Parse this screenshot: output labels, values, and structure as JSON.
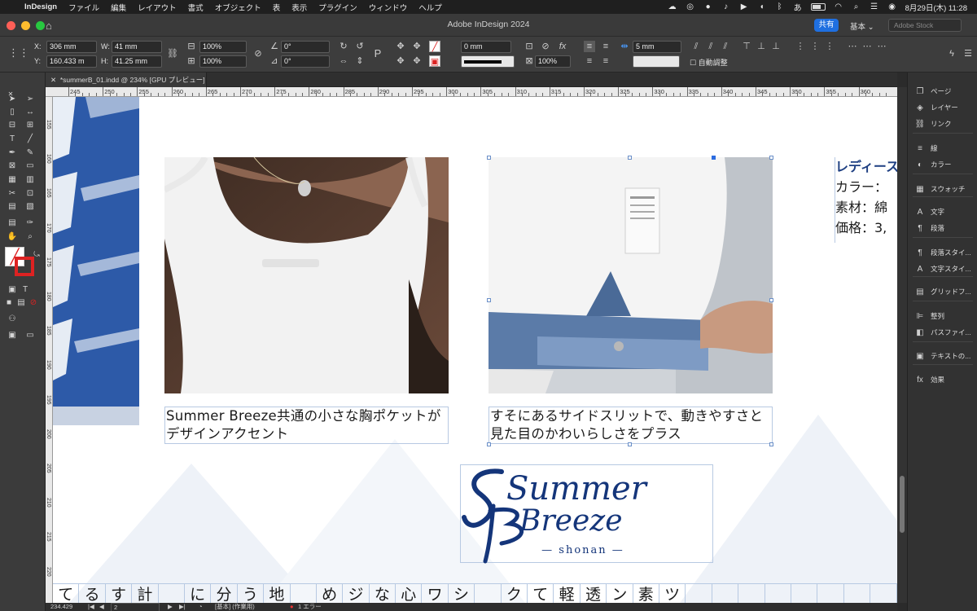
{
  "menubar": {
    "app_name": "InDesign",
    "items": [
      "ファイル",
      "編集",
      "レイアウト",
      "書式",
      "オブジェクト",
      "表",
      "表示",
      "プラグイン",
      "ウィンドウ",
      "ヘルプ"
    ],
    "ime": "あ",
    "datetime": "8月29日(木) 11:28"
  },
  "window": {
    "title": "Adobe InDesign 2024",
    "share_label": "共有",
    "workspace_label": "基本 ⌄",
    "stock_placeholder": "Adobe Stock"
  },
  "control": {
    "x_label": "X:",
    "x_value": "306 mm",
    "y_label": "Y:",
    "y_value": "160.433 m",
    "w_label": "W:",
    "w_value": "41 mm",
    "h_label": "H:",
    "h_value": "41.25 mm",
    "scale_x": "100%",
    "scale_y": "100%",
    "rotate": "0°",
    "shear": "0°",
    "stroke_weight": "0 mm",
    "opacity": "100%",
    "gap": "5 mm",
    "auto_fit_label": "自動調整"
  },
  "tab": {
    "label": "*summerB_01.indd @ 234% [GPU プレビュー]"
  },
  "rulers": {
    "top": [
      "245",
      "250",
      "255",
      "260",
      "265",
      "270",
      "275",
      "280",
      "285",
      "290",
      "295",
      "300",
      "305",
      "310",
      "315",
      "320",
      "325",
      "330",
      "335",
      "340",
      "345",
      "350",
      "355",
      "360"
    ],
    "left": [
      "155",
      "160",
      "165",
      "170",
      "175",
      "180",
      "185",
      "190",
      "195",
      "200",
      "205",
      "210",
      "215",
      "220"
    ]
  },
  "document": {
    "caption1": "Summer Breeze共通の小さな胸ポケットがデザインアクセント",
    "caption2": "すそにあるサイドスリットで、動きやすさと見た目のかわいらしさをプラス",
    "right_title": "レディース",
    "right_lines": [
      "カラー：",
      "素材：綿",
      "価格：3,"
    ],
    "logo_line1": "Summer",
    "logo_line2": "Breeze",
    "logo_sub": "— shonan —",
    "bottom_chars": [
      "て",
      "る",
      "す",
      "計",
      "",
      "に",
      "分",
      "う",
      "地",
      "",
      "め",
      "ジ",
      "な",
      "心",
      "ワ",
      "シ",
      "",
      "ク",
      "て",
      "軽",
      "透",
      "ン",
      "素",
      "ツ",
      "",
      "",
      "",
      "",
      "",
      "",
      "",
      ""
    ]
  },
  "panels": [
    {
      "name": "pages",
      "icon": "pages-icon",
      "label": "ページ"
    },
    {
      "name": "layers",
      "icon": "layers-icon",
      "label": "レイヤー"
    },
    {
      "name": "links",
      "icon": "link-icon",
      "label": "リンク"
    },
    {
      "name": "stroke",
      "icon": "stroke-icon",
      "label": "線"
    },
    {
      "name": "color",
      "icon": "color-icon",
      "label": "カラー"
    },
    {
      "name": "swatches",
      "icon": "swatch-icon",
      "label": "スウォッチ"
    },
    {
      "name": "character",
      "icon": "character-icon",
      "label": "文字"
    },
    {
      "name": "paragraph",
      "icon": "paragraph-icon",
      "label": "段落"
    },
    {
      "name": "paragraph-styles",
      "icon": "paragraph-style-icon",
      "label": "段落スタイ..."
    },
    {
      "name": "character-styles",
      "icon": "character-style-icon",
      "label": "文字スタイ..."
    },
    {
      "name": "grid-format",
      "icon": "grid-icon",
      "label": "グリッドフ..."
    },
    {
      "name": "align",
      "icon": "align-icon",
      "label": "整列"
    },
    {
      "name": "pathfinder",
      "icon": "pathfinder-icon",
      "label": "パスファイ..."
    },
    {
      "name": "text-wrap",
      "icon": "text-wrap-icon",
      "label": "テキストの..."
    },
    {
      "name": "effects",
      "icon": "fx-icon",
      "label": "効果"
    }
  ],
  "status": {
    "zoom": "234.429",
    "page": "2",
    "style": "[基本] (作業用)",
    "errors": "1 エラー"
  },
  "colors": {
    "accent": "#1f6fe0",
    "logo_navy": "#14357a",
    "frame_outline": "#b7c9e2"
  }
}
